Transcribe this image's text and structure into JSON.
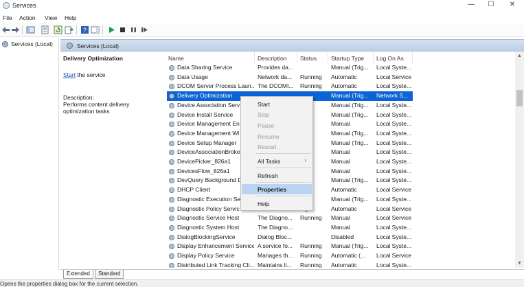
{
  "window": {
    "title": "Services",
    "controls": [
      "—",
      "☐",
      "✕"
    ]
  },
  "menu": [
    "File",
    "Action",
    "View",
    "Help"
  ],
  "toolbar_icons": [
    "back-arrow-icon",
    "forward-arrow-icon",
    "console-tree-icon",
    "properties-sheet-icon",
    "refresh-icon",
    "export-list-icon",
    "help-icon",
    "show-hide-pane-icon",
    "start-service-icon",
    "stop-service-icon",
    "pause-service-icon",
    "restart-service-icon"
  ],
  "tree": {
    "root_label": "Services (Local)"
  },
  "pane": {
    "header": "Services (Local)"
  },
  "details": {
    "service_name": "Delivery Optimization",
    "start_link": "Start",
    "start_suffix": " the service",
    "description_label": "Description:",
    "description_text": "Performs content delivery optimization tasks"
  },
  "columns": [
    "Name",
    "Description",
    "Status",
    "Startup Type",
    "Log On As"
  ],
  "rows": [
    [
      "Data Sharing Service",
      "Provides da...",
      "",
      "Manual (Trig...",
      "Local Syste..."
    ],
    [
      "Data Usage",
      "Network da...",
      "Running",
      "Automatic",
      "Local Service"
    ],
    [
      "DCOM Server Process Laun...",
      "The DCOMI...",
      "Running",
      "Automatic",
      "Local Syste..."
    ],
    [
      "Delivery Optimization",
      "",
      "",
      "Manual (Trig...",
      "Network S..."
    ],
    [
      "Device Association Serv",
      "",
      "ing",
      "Manual (Trig...",
      "Local Syste..."
    ],
    [
      "Device Install Service",
      "",
      "",
      "Manual (Trig...",
      "Local Syste..."
    ],
    [
      "Device Management En",
      "",
      "",
      "Manual",
      "Local Syste..."
    ],
    [
      "Device Management Wi",
      "",
      "",
      "Manual (Trig...",
      "Local Syste..."
    ],
    [
      "Device Setup Manager",
      "",
      "",
      "Manual (Trig...",
      "Local Syste..."
    ],
    [
      "DeviceAssociationBroke",
      "",
      "",
      "Manual",
      "Local Syste..."
    ],
    [
      "DevicePicker_826a1",
      "",
      "",
      "Manual",
      "Local Syste..."
    ],
    [
      "DevicesFlow_826a1",
      "",
      "",
      "Manual",
      "Local Syste..."
    ],
    [
      "DevQuery Background D",
      "",
      "",
      "Manual (Trig...",
      "Local Syste..."
    ],
    [
      "DHCP Client",
      "",
      "ing",
      "Automatic",
      "Local Service"
    ],
    [
      "Diagnostic Execution Se",
      "",
      "",
      "Manual (Trig...",
      "Local Syste..."
    ],
    [
      "Diagnostic Policy Servic",
      "",
      "ing",
      "Automatic",
      "Local Service"
    ],
    [
      "Diagnostic Service Host",
      "The Diagno...",
      "Running",
      "Manual",
      "Local Service"
    ],
    [
      "Diagnostic System Host",
      "The Diagno...",
      "",
      "Manual",
      "Local Syste..."
    ],
    [
      "DialogBlockingService",
      "Dialog Bloc...",
      "",
      "Disabled",
      "Local Syste..."
    ],
    [
      "Display Enhancement Service",
      "A service fo...",
      "Running",
      "Manual (Trig...",
      "Local Syste..."
    ],
    [
      "Display Policy Service",
      "Manages th...",
      "Running",
      "Automatic (...",
      "Local Service"
    ],
    [
      "Distributed Link Tracking Cli...",
      "Maintains li...",
      "Running",
      "Automatic",
      "Local Syste..."
    ]
  ],
  "selected_row_index": 3,
  "context_menu": {
    "items": [
      {
        "label": "Start",
        "disabled": false
      },
      {
        "label": "Stop",
        "disabled": true
      },
      {
        "label": "Pause",
        "disabled": true
      },
      {
        "label": "Resume",
        "disabled": true
      },
      {
        "label": "Restart",
        "disabled": true
      },
      {
        "label": "All Tasks",
        "disabled": false,
        "submenu": "›"
      },
      {
        "label": "Refresh",
        "disabled": false
      },
      {
        "label": "Properties",
        "disabled": false
      },
      {
        "label": "Help",
        "disabled": false
      }
    ],
    "highlighted": "Properties"
  },
  "tabs": [
    "Extended",
    "Standard"
  ],
  "status": "Opens the properties dialog box for the current selection.",
  "colors": {
    "selection": "#0a64d6",
    "menu_highlight": "#b9d3f0",
    "pane_header": "#c8d7ea",
    "link": "#1a4fb3"
  }
}
